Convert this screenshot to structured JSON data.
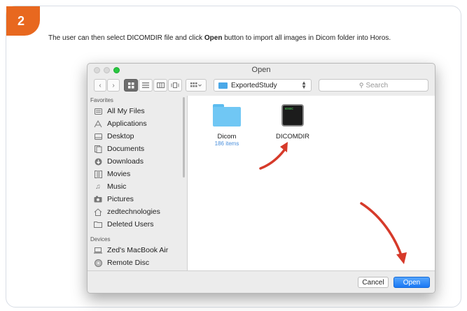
{
  "step": {
    "number": "2",
    "color": "#e8681f"
  },
  "instruction": {
    "before": "The user can then select DICOMDIR file and click ",
    "bold": "Open",
    "after": " button to import all images in Dicom folder into Horos."
  },
  "dialog": {
    "title": "Open",
    "toolbar": {
      "back_icon": "chevron-left-icon",
      "forward_icon": "chevron-right-icon",
      "view_icons": [
        "icon-view-icon",
        "list-view-icon",
        "column-view-icon",
        "coverflow-view-icon"
      ],
      "arrange_icon": "arrange-icon",
      "folder": "ExportedStudy",
      "search_placeholder": "Search"
    },
    "sidebar": {
      "favorites_header": "Favorites",
      "favorites": [
        {
          "label": "All My Files",
          "icon": "all-files-icon"
        },
        {
          "label": "Applications",
          "icon": "applications-icon"
        },
        {
          "label": "Desktop",
          "icon": "desktop-icon"
        },
        {
          "label": "Documents",
          "icon": "documents-icon"
        },
        {
          "label": "Downloads",
          "icon": "downloads-icon"
        },
        {
          "label": "Movies",
          "icon": "movies-icon"
        },
        {
          "label": "Music",
          "icon": "music-icon"
        },
        {
          "label": "Pictures",
          "icon": "pictures-icon"
        },
        {
          "label": "zedtechnologies",
          "icon": "home-icon"
        },
        {
          "label": "Deleted Users",
          "icon": "folder-icon"
        }
      ],
      "devices_header": "Devices",
      "devices": [
        {
          "label": "Zed's MacBook Air",
          "icon": "laptop-icon"
        },
        {
          "label": "Remote Disc",
          "icon": "disc-icon"
        }
      ]
    },
    "files": [
      {
        "name": "Dicom",
        "sub": "186 items",
        "icon": "folder-icon"
      },
      {
        "name": "DICOMDIR",
        "sub": "",
        "icon": "exec-icon",
        "badge": "exec"
      }
    ],
    "buttons": {
      "cancel": "Cancel",
      "open": "Open"
    }
  },
  "colors": {
    "accent": "#1a78f4",
    "annotation": "#d63a2a",
    "folder": "#70c7f4"
  }
}
